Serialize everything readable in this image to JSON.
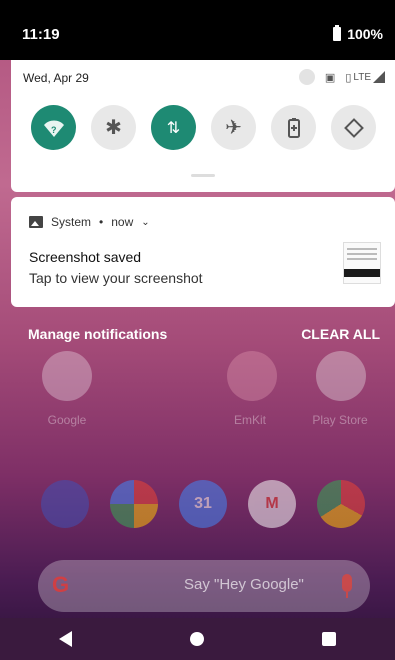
{
  "status_bar": {
    "time": "11:19",
    "battery": "100%"
  },
  "quick_settings": {
    "date": "Wed, Apr 29",
    "network": "LTE",
    "tiles": [
      {
        "name": "wifi-icon",
        "state": "on"
      },
      {
        "name": "bluetooth-icon",
        "state": "off"
      },
      {
        "name": "mobile-data-icon",
        "state": "on"
      },
      {
        "name": "airplane-icon",
        "state": "off"
      },
      {
        "name": "battery-saver-icon",
        "state": "off"
      },
      {
        "name": "auto-rotate-icon",
        "state": "off"
      }
    ]
  },
  "notification": {
    "app": "System",
    "time": "now",
    "title": "Screenshot saved",
    "text": "Tap to view your screenshot"
  },
  "actions": {
    "manage": "Manage notifications",
    "clear_all": "CLEAR ALL"
  },
  "home_apps": [
    {
      "label": "Google"
    },
    {
      "label": "EmKit"
    },
    {
      "label": "Play Store"
    }
  ],
  "dock_apps": [
    "contacts-icon",
    "photos-icon",
    "calendar-icon",
    "gmail-icon",
    "chrome-icon"
  ],
  "calendar_day": "31",
  "search": {
    "placeholder": "Say \"Hey Google\""
  },
  "colors": {
    "accent": "#1e8a73"
  }
}
